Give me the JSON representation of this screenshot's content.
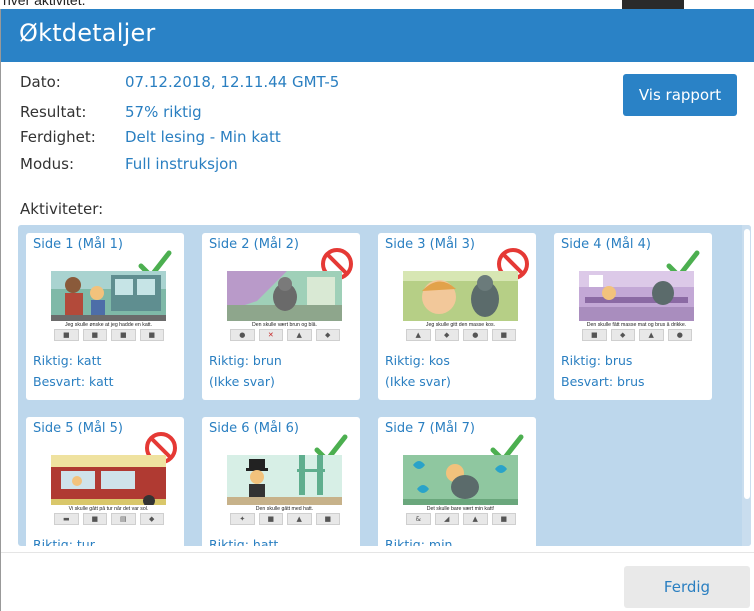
{
  "background": {
    "partial_text": "hver aktivitet."
  },
  "dialog": {
    "title": "Øktdetaljer",
    "header_color": "#2a82c6",
    "accent_color": "#2a7fc1"
  },
  "info": {
    "date_label": "Dato:",
    "date_value": "07.12.2018, 12.11.44 GMT-5",
    "result_label": "Resultat:",
    "result_value": "57% riktig",
    "skill_label": "Ferdighet:",
    "skill_value": "Delt lesing - Min katt",
    "mode_label": "Modus:",
    "mode_value": "Full instruksjon"
  },
  "report_button": {
    "label": "Vis rapport"
  },
  "activities_label": "Aktiviteter:",
  "activities": [
    {
      "title": "Side 1 (Mål 1)",
      "status": "correct",
      "caption": "Jeg skulle ønske at jeg hadde en katt.",
      "line1": "Riktig: katt",
      "line2": "Besvart: katt"
    },
    {
      "title": "Side 2 (Mål 2)",
      "status": "no-answer",
      "caption": "Den skulle vært brun og blå.",
      "line1": "Riktig: brun",
      "line2": "(Ikke svar)"
    },
    {
      "title": "Side 3 (Mål 3)",
      "status": "no-answer",
      "caption": "Jeg skulle gitt den masse kos.",
      "line1": "Riktig: kos",
      "line2": "(Ikke svar)"
    },
    {
      "title": "Side 4 (Mål 4)",
      "status": "correct",
      "caption": "Den skulle fått masse mat og brus å drikke.",
      "line1": "Riktig: brus",
      "line2": "Besvart: brus"
    },
    {
      "title": "Side 5 (Mål 5)",
      "status": "no-answer",
      "caption": "Vi skulle gått på tur når det var sol.",
      "line1": "Riktig: tur",
      "line2": ""
    },
    {
      "title": "Side 6 (Mål 6)",
      "status": "correct",
      "caption": "Den skulle gått med hatt.",
      "line1": "Riktig: hatt",
      "line2": ""
    },
    {
      "title": "Side 7 (Mål 7)",
      "status": "correct",
      "caption": "Det skulle bare vært min katt!",
      "line1": "Riktig: min",
      "line2": ""
    }
  ],
  "status_colors": {
    "correct": "#4caf50",
    "no_answer": "#e53935"
  },
  "done_button": {
    "label": "Ferdig"
  }
}
